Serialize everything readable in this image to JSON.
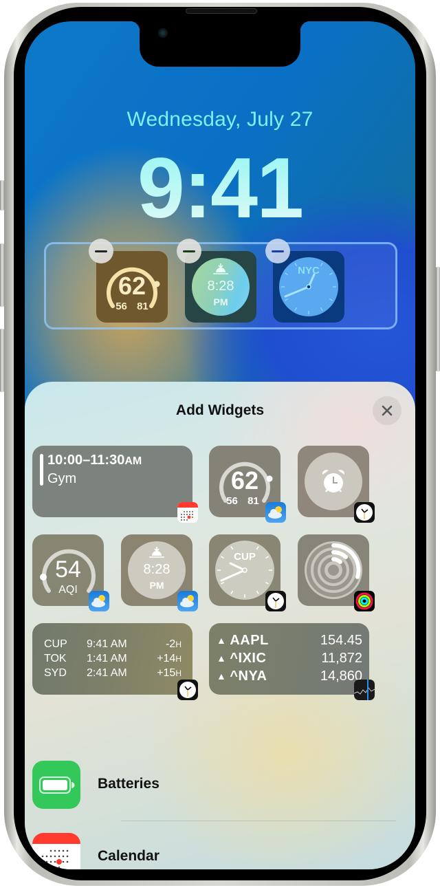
{
  "lock_screen": {
    "date": "Wednesday, July 27",
    "time": "9:41",
    "widgets": [
      {
        "type": "weather-temperature",
        "current": "62",
        "low": "56",
        "high": "81"
      },
      {
        "type": "sunset",
        "time": "8:28",
        "period": "PM"
      },
      {
        "type": "world-clock",
        "city": "NYC"
      }
    ],
    "remove_button_icon": "minus-icon"
  },
  "add_widgets": {
    "title": "Add Widgets",
    "close_icon": "close-icon",
    "gallery": {
      "calendar_event": {
        "time": "10:00–11:30",
        "period": "AM",
        "event": "Gym",
        "app": "Calendar"
      },
      "weather_temp": {
        "current": "62",
        "low": "56",
        "high": "81",
        "app": "Weather"
      },
      "alarm": {
        "app": "Clock"
      },
      "aqi": {
        "value": "54",
        "label": "AQI",
        "app": "Weather"
      },
      "sunset": {
        "time": "8:28",
        "period": "PM",
        "app": "Weather"
      },
      "city_clock": {
        "city": "CUP",
        "app": "Clock"
      },
      "activity": {
        "app": "Fitness"
      },
      "world_clock": {
        "app": "Clock",
        "rows": [
          {
            "city": "CUP",
            "time": "9:41 AM",
            "offset": "-2",
            "unit": "H"
          },
          {
            "city": "TOK",
            "time": "1:41 AM",
            "offset": "+14",
            "unit": "H"
          },
          {
            "city": "SYD",
            "time": "2:41 AM",
            "offset": "+15",
            "unit": "H"
          }
        ]
      },
      "stocks": {
        "app": "Stocks",
        "rows": [
          {
            "symbol": "AAPL",
            "value": "154.45"
          },
          {
            "symbol": "^IXIC",
            "value": "11,872"
          },
          {
            "symbol": "^NYA",
            "value": "14,860"
          }
        ]
      }
    },
    "apps": [
      {
        "name": "Batteries",
        "color": "#34c759"
      },
      {
        "name": "Calendar",
        "color": "#ff3b30"
      }
    ]
  },
  "colors": {
    "date_text": "#7df0f2",
    "tray_border": "#96c8ff",
    "batteries_green": "#34c759",
    "calendar_red": "#ff3b30"
  }
}
